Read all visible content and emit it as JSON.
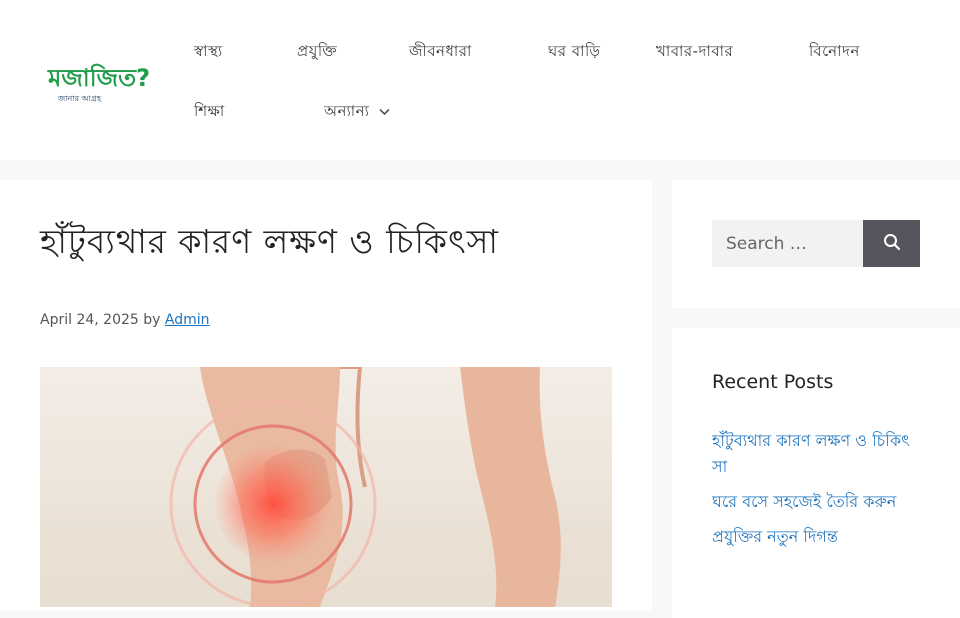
{
  "site": {
    "logo_text": "মজাজিত?",
    "logo_subtext": "জানার আগ্রহ"
  },
  "nav": {
    "items": [
      {
        "label": "স্বাস্থ্য"
      },
      {
        "label": "প্রযুক্তি"
      },
      {
        "label": "জীবনধারা"
      },
      {
        "label": "ঘর বাড়ি"
      },
      {
        "label": "খাবার-দাবার"
      },
      {
        "label": "বিনোদন"
      },
      {
        "label": "শিক্ষা"
      },
      {
        "label": "অন্যান্য",
        "has_dropdown": true
      }
    ]
  },
  "post": {
    "title": "হাঁটুব্যথার কারণ লক্ষণ ও চিকিৎসা",
    "date": "April 24, 2025",
    "by": "by",
    "author": "Admin"
  },
  "search": {
    "placeholder": "Search …"
  },
  "recent": {
    "title": "Recent Posts",
    "posts": [
      "হাঁটুব্যথার কারণ লক্ষণ ও চিকিৎসা",
      "ঘরে বসে সহজেই তৈরি করুন",
      "প্রযুক্তির নতুন দিগন্ত"
    ]
  },
  "colors": {
    "link": "#1e73be",
    "search_button": "#55555e",
    "page_bg": "#f7f8f9",
    "logo_green": "#1f9d4a",
    "logo_dark": "#1b3a5c"
  }
}
